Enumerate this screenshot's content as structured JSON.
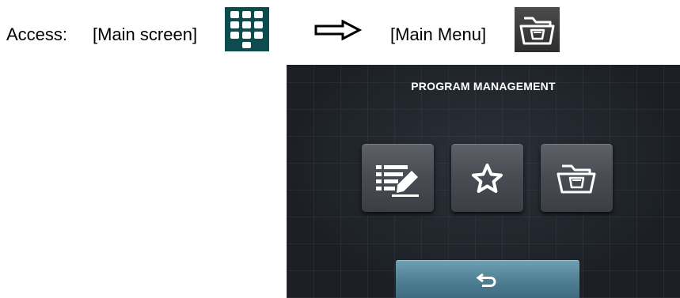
{
  "access": {
    "label": "Access:",
    "main_screen": "[Main screen]",
    "main_menu": "[Main Menu]",
    "icons": {
      "main_screen": "grid-icon",
      "arrow": "right-arrow-icon",
      "main_menu": "program-folder-icon"
    }
  },
  "screen": {
    "title": "PROGRAM MANAGEMENT",
    "tiles": [
      {
        "icon": "list-edit-icon"
      },
      {
        "icon": "star-icon"
      },
      {
        "icon": "program-folder-icon"
      }
    ],
    "back_button": {
      "icon": "back-arrow-icon"
    }
  },
  "colors": {
    "main_screen_icon_bg": "#0d4b4e",
    "screen_bg": "#1c2026",
    "tile_bg": "#4a4e54",
    "back_button_bg": "#4f7f93"
  }
}
